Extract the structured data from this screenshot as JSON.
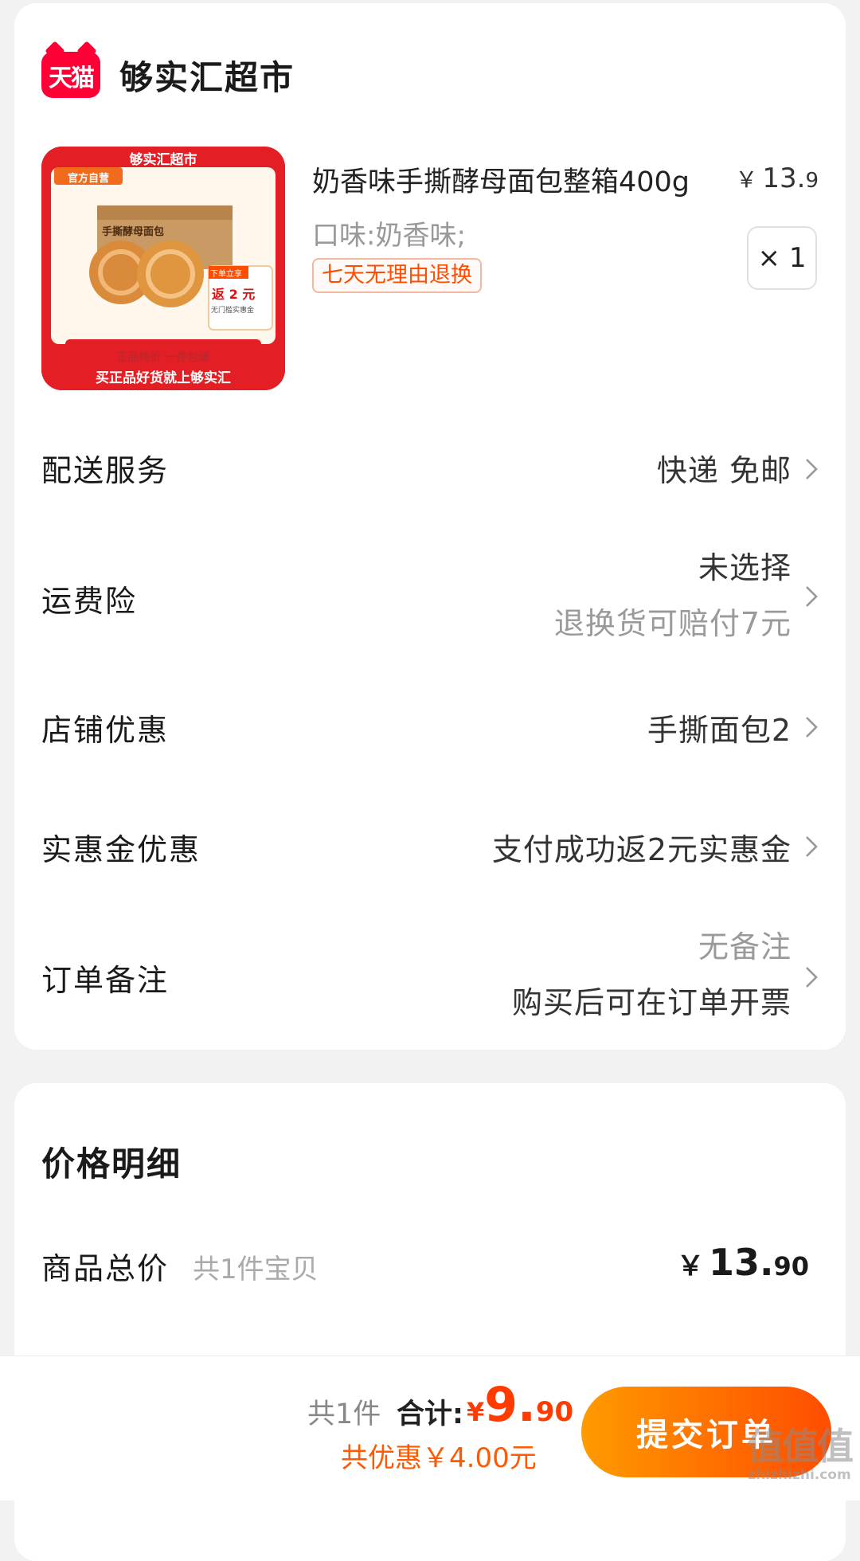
{
  "store": {
    "logo_text": "天猫",
    "name": "够实汇超市"
  },
  "product": {
    "image_banner": "够实汇超市",
    "image_badge": "官方自营",
    "image_box_text": "手撕酵母面包",
    "image_promo_top": "下单立享",
    "image_promo_main": "返 2 元",
    "image_promo_sub": "无门槛实惠金",
    "image_slogan_1": "正品特价  一件包邮",
    "image_slogan_2": "买正品好货就上够实汇",
    "title": "奶香味手撕酵母面包整箱400g",
    "price_symbol": "￥",
    "price_int": "13.",
    "price_dec": "9",
    "spec": "口味:奶香味;",
    "tag": "七天无理由退换",
    "qty": "× 1"
  },
  "rows": {
    "delivery": {
      "label": "配送服务",
      "value": "快递 免邮"
    },
    "insurance": {
      "label": "运费险",
      "value_main": "未选择",
      "value_sub": "退换货可赔付7元"
    },
    "store_discount": {
      "label": "店铺优惠",
      "value": "手撕面包2"
    },
    "cashback": {
      "label": "实惠金优惠",
      "value": "支付成功返2元实惠金"
    },
    "remark": {
      "label": "订单备注",
      "value_main": "无备注",
      "value_sub": "购买后可在订单开票"
    }
  },
  "price_detail": {
    "title": "价格明细",
    "total_label": "商品总价",
    "total_sub": "共1件宝贝",
    "symbol": "￥",
    "int": "13.",
    "dec": "90"
  },
  "bottom_bar": {
    "count": "共1件",
    "total_label": "合计:",
    "symbol": "¥",
    "int": "9.",
    "dec": "90",
    "discount": "共优惠￥4.00元",
    "submit": "提交订单"
  },
  "watermark": {
    "big": "值值值",
    "small": "zhizhizhi.com"
  },
  "colors": {
    "accent": "#ff5a00",
    "tmall_red": "#ff0036",
    "button_start": "#ff9b00",
    "button_end": "#ff4d00"
  }
}
